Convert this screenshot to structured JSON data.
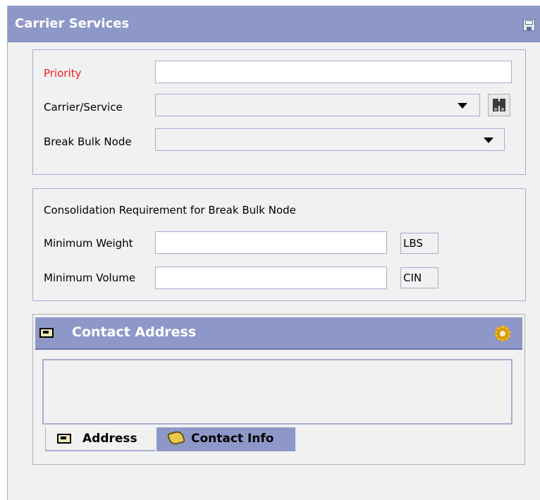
{
  "window": {
    "title": "Carrier Services",
    "save_icon": "save-icon"
  },
  "routing": {
    "priority_label": "Priority",
    "priority_value": "",
    "carrier_label": "Carrier/Service",
    "carrier_value": "",
    "break_bulk_label": "Break Bulk Node",
    "break_bulk_value": "",
    "lookup_icon": "binoculars-icon"
  },
  "consolidation": {
    "heading": "Consolidation Requirement for Break Bulk Node",
    "min_weight_label": "Minimum Weight",
    "min_weight_value": "",
    "weight_unit": "LBS",
    "min_volume_label": "Minimum Volume",
    "min_volume_value": "",
    "volume_unit": "CIN"
  },
  "contact_panel": {
    "title": "Contact Address",
    "header_icon": "address-card-icon",
    "settings_icon": "gear-icon",
    "tabs": [
      {
        "label": "Address",
        "icon": "address-card-icon",
        "active": true
      },
      {
        "label": "Contact Info",
        "icon": "contact-card-icon",
        "active": false
      }
    ]
  },
  "colors": {
    "titlebar": "#8e98c8",
    "required_label": "#ee1c1c",
    "border": "#a8acd0"
  }
}
